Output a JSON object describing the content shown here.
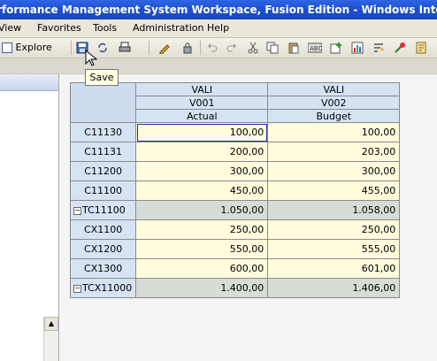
{
  "window": {
    "title": "rformance Management System Workspace, Fusion Edition - Windows Internet Explorer"
  },
  "menubar": {
    "items": [
      "View",
      "Favorites",
      "Tools",
      "Administration",
      "Help"
    ]
  },
  "toolbar": {
    "explore_label": "Explore",
    "tooltip": "Save"
  },
  "grid": {
    "column_headers": {
      "row1": [
        "VALI",
        "VALI"
      ],
      "row2": [
        "V001",
        "V002"
      ],
      "row3": [
        "Actual",
        "Budget"
      ]
    },
    "rows": [
      {
        "label": "C11130",
        "actual": "100,00",
        "budget": "100,00",
        "type": "leaf"
      },
      {
        "label": "C11131",
        "actual": "200,00",
        "budget": "203,00",
        "type": "leaf"
      },
      {
        "label": "C11200",
        "actual": "300,00",
        "budget": "300,00",
        "type": "leaf"
      },
      {
        "label": "C11100",
        "actual": "450,00",
        "budget": "455,00",
        "type": "leaf"
      },
      {
        "label": "TC11100",
        "actual": "1.050,00",
        "budget": "1.058,00",
        "type": "total"
      },
      {
        "label": "CX1100",
        "actual": "250,00",
        "budget": "250,00",
        "type": "leaf"
      },
      {
        "label": "CX1200",
        "actual": "550,00",
        "budget": "555,00",
        "type": "leaf"
      },
      {
        "label": "CX1300",
        "actual": "600,00",
        "budget": "601,00",
        "type": "leaf"
      },
      {
        "label": "TCX11000",
        "actual": "1.400,00",
        "budget": "1.406,00",
        "type": "total"
      }
    ],
    "selected_cell": "C11130-actual",
    "colors": {
      "header_bg": "#d6e3f3",
      "data_bg": "#fffbdc",
      "total_bg": "#d6ddd6"
    }
  }
}
